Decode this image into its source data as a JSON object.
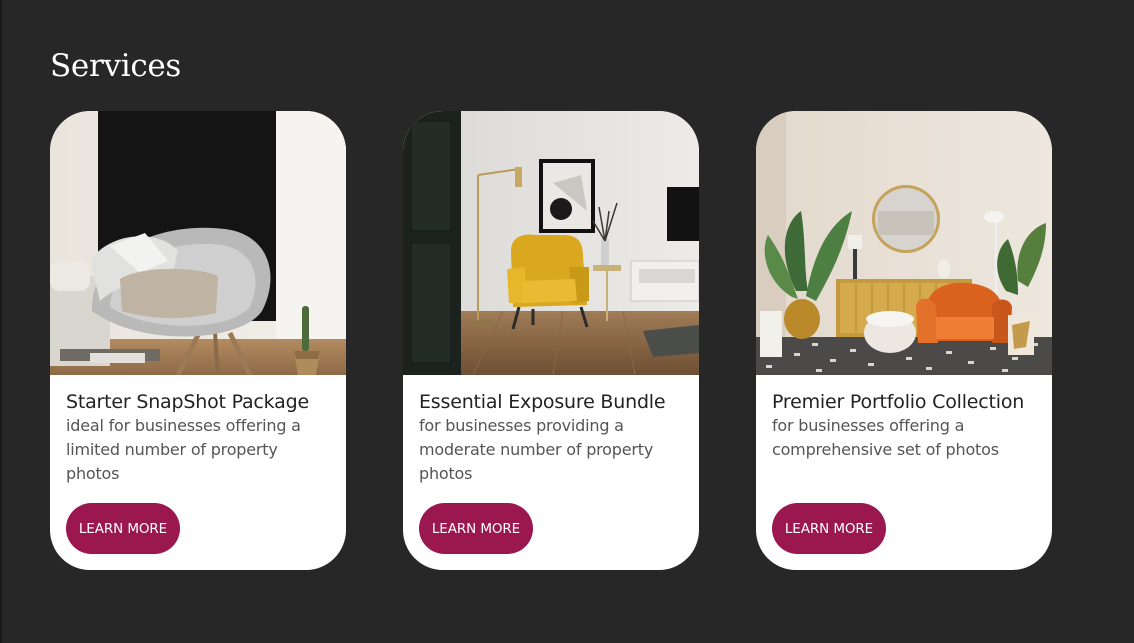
{
  "section": {
    "title": "Services"
  },
  "colors": {
    "background": "#272727",
    "card_background": "#ffffff",
    "button": "#9a1750",
    "button_text": "#ffffff",
    "title_text": "#222222",
    "desc_text": "#555555"
  },
  "cards": [
    {
      "image_name": "grey-chair-room-image",
      "title": "Starter SnapShot Package",
      "description": "ideal for businesses offering a limited number of property photos",
      "button_label": "LEARN MORE"
    },
    {
      "image_name": "yellow-armchair-room-image",
      "title": "Essential Exposure Bundle",
      "description": "for businesses providing a moderate number of property photos",
      "button_label": "LEARN MORE"
    },
    {
      "image_name": "orange-armchair-living-room-image",
      "title": "Premier Portfolio Collection",
      "description": "for businesses offering a comprehensive set of photos",
      "button_label": "LEARN MORE"
    }
  ]
}
